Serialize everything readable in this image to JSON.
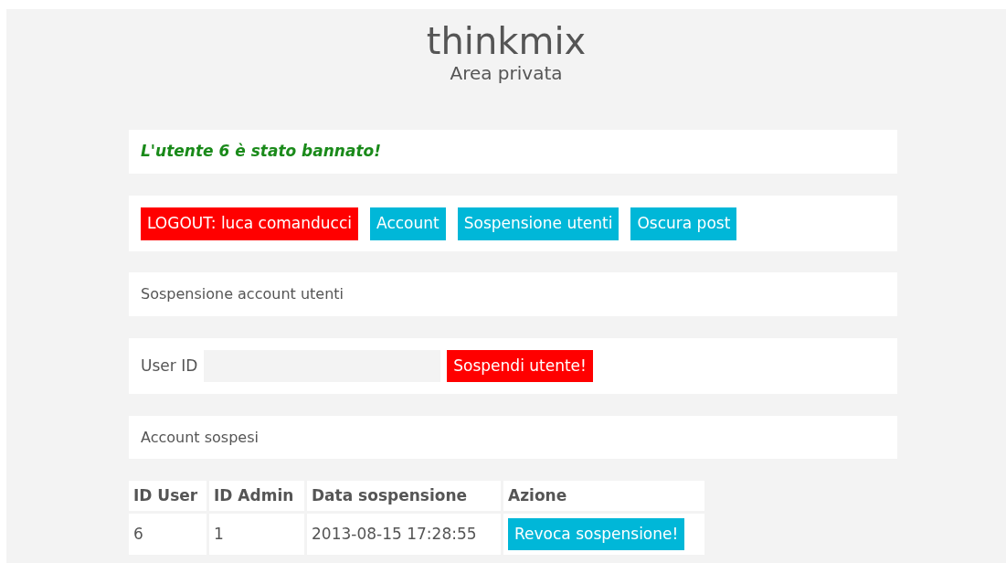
{
  "header": {
    "title": "thinkmix",
    "subtitle": "Area privata"
  },
  "alert": {
    "message": "L'utente 6 è stato bannato!"
  },
  "nav_buttons": [
    {
      "label": "LOGOUT: luca comanducci",
      "kind": "danger"
    },
    {
      "label": "Account",
      "kind": "info"
    },
    {
      "label": "Sospensione utenti",
      "kind": "info"
    },
    {
      "label": "Oscura post",
      "kind": "info"
    }
  ],
  "section_title": "Sospensione account utenti",
  "suspend_form": {
    "label": "User ID",
    "button": "Sospendi utente!"
  },
  "list_title": "Account sospesi",
  "table": {
    "columns": [
      "ID User",
      "ID Admin",
      "Data sospensione",
      "Azione"
    ],
    "rows": [
      {
        "cells": [
          "6",
          "1",
          "2013-08-15 17:28:55"
        ],
        "action": "Revoca sospensione!"
      }
    ]
  }
}
